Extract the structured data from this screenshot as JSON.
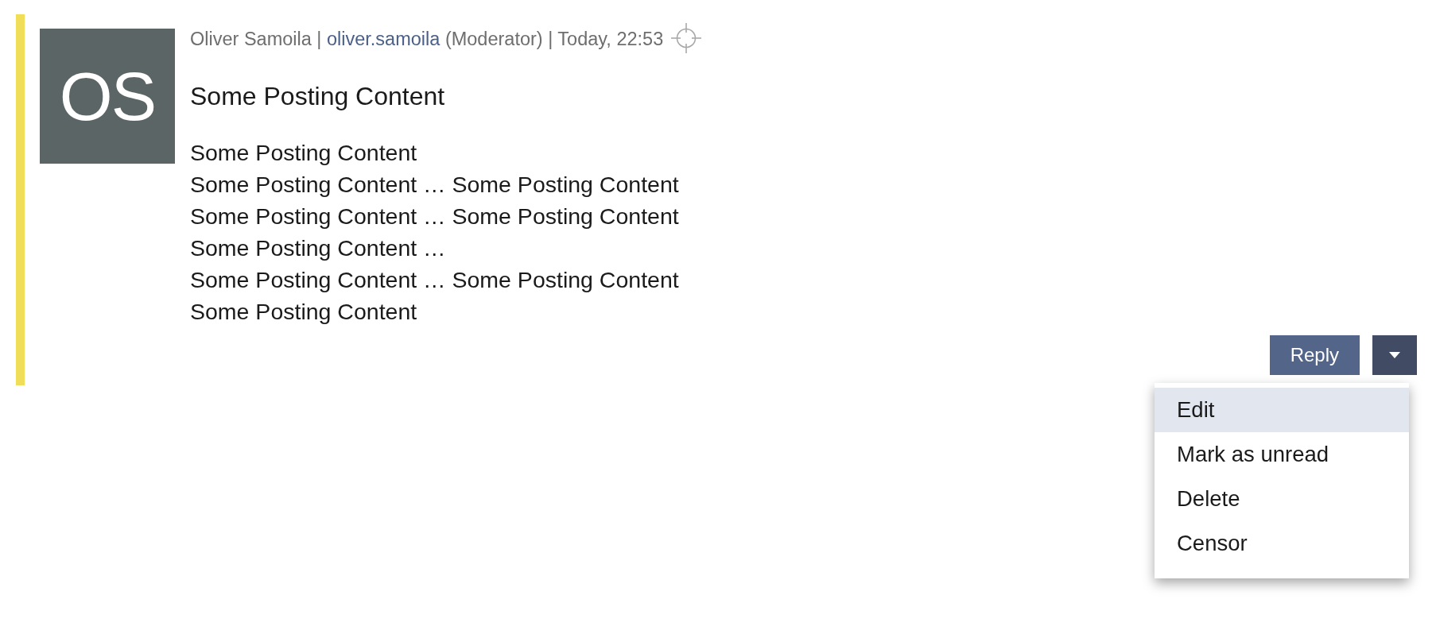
{
  "post": {
    "highlighted": true,
    "avatar": {
      "initials": "OS"
    },
    "meta": [
      {
        "kind": "text",
        "text": "Oliver Samoila |"
      },
      {
        "kind": "link",
        "text": "oliver.samoila"
      },
      {
        "kind": "text",
        "text": "(Moderator) | Today, 22:53"
      }
    ],
    "title": "Some Posting Content",
    "body": [
      "Some Posting Content",
      "Some Posting Content … Some Posting Content",
      "Some Posting Content … Some Posting Content",
      "Some Posting Content …",
      "Some Posting Content … Some Posting Content",
      "Some Posting Content"
    ],
    "reply_button": {
      "label": "Reply"
    },
    "menu": {
      "expanded": true,
      "items": [
        {
          "label": "Edit",
          "selected": true
        },
        {
          "label": "Mark as unread",
          "selected": false
        },
        {
          "label": "Delete",
          "selected": false
        },
        {
          "label": "Censor",
          "selected": false
        }
      ]
    }
  }
}
